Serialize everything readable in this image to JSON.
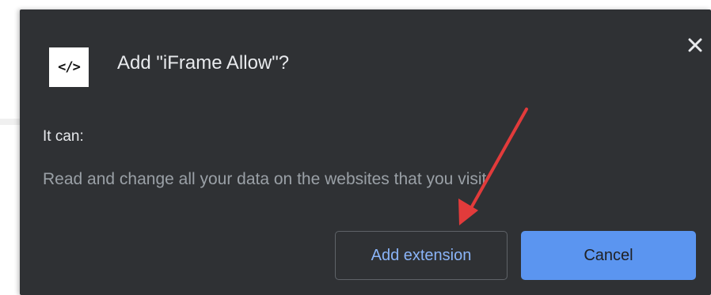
{
  "dialog": {
    "title": "Add \"iFrame Allow\"?",
    "icon": {
      "name": "code-brackets-icon",
      "glyph": "</>"
    },
    "close_icon": "close-icon",
    "permissions_heading": "It can:",
    "permissions": [
      "Read and change all your data on the websites that you visit"
    ],
    "buttons": {
      "add_label": "Add extension",
      "cancel_label": "Cancel"
    }
  },
  "annotation": {
    "type": "arrow",
    "color": "#e23b3b",
    "points_to": "add-extension-button"
  },
  "colors": {
    "dialog_background": "#2f3134",
    "title_text": "#e8eaed",
    "secondary_text": "#9aa0a6",
    "link_blue": "#8ab4f8",
    "primary_button": "#5b95f0",
    "button_border": "#5f6368"
  }
}
